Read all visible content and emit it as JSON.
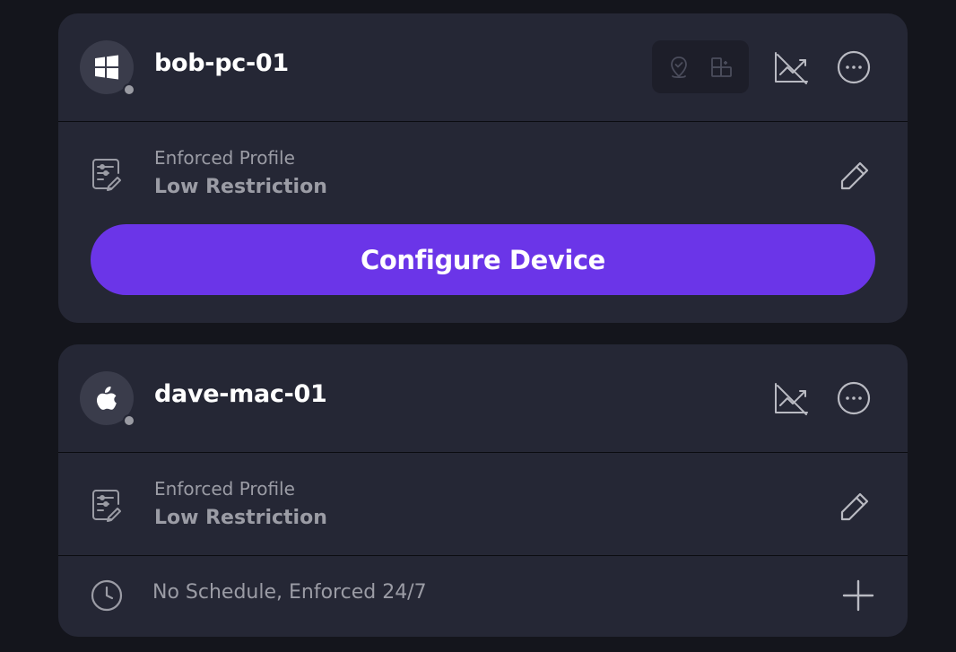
{
  "devices": [
    {
      "name": "bob-pc-01",
      "os_icon": "windows-icon",
      "status_color": "#9a9ba3",
      "extra_icons": [
        "location-pin-icon",
        "app-blocks-icon"
      ],
      "activity_icon": "activity-off-icon",
      "menu_icon": "more-options-icon",
      "profile_label": "Enforced Profile",
      "profile_value": "Low Restriction",
      "configure_label": "Configure Device"
    },
    {
      "name": "dave-mac-01",
      "os_icon": "apple-icon",
      "status_color": "#9a9ba3",
      "activity_icon": "activity-off-icon",
      "menu_icon": "more-options-icon",
      "profile_label": "Enforced Profile",
      "profile_value": "Low Restriction",
      "schedule_text": "No Schedule, Enforced 24/7"
    }
  ],
  "colors": {
    "background": "#14151c",
    "card": "#252735",
    "accent": "#6b35e8",
    "muted_text": "#9b9ca5"
  }
}
